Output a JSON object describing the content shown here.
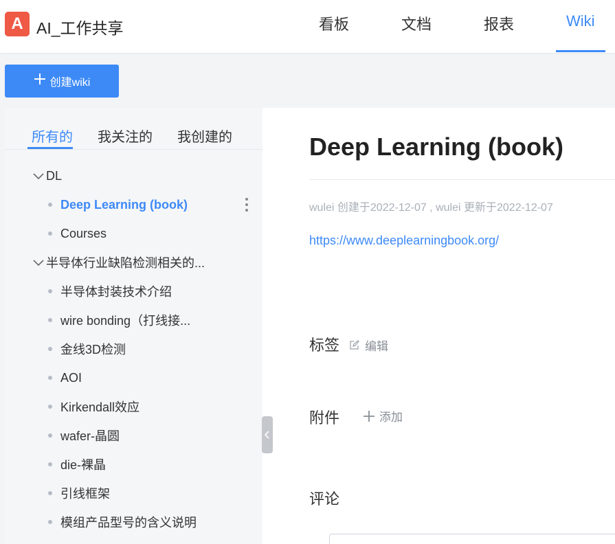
{
  "app": {
    "logo_letter": "A",
    "title": "AI_工作共享"
  },
  "nav": {
    "items": [
      "看板",
      "文档",
      "报表",
      "Wiki"
    ],
    "active": "Wiki"
  },
  "create_button": {
    "label": "创建wiki"
  },
  "sidebar": {
    "tabs": [
      "所有的",
      "我关注的",
      "我创建的"
    ],
    "active_tab": "所有的",
    "tree": [
      {
        "type": "folder",
        "label": "DL"
      },
      {
        "type": "leaf",
        "label": "Deep Learning (book)",
        "selected": true
      },
      {
        "type": "leaf",
        "label": "Courses"
      },
      {
        "type": "folder",
        "label": "半导体行业缺陷检测相关的..."
      },
      {
        "type": "leaf",
        "label": "半导体封装技术介绍"
      },
      {
        "type": "leaf",
        "label": "wire bonding（打线接..."
      },
      {
        "type": "leaf",
        "label": "金线3D检测"
      },
      {
        "type": "leaf",
        "label": "AOI"
      },
      {
        "type": "leaf",
        "label": "Kirkendall效应"
      },
      {
        "type": "leaf",
        "label": "wafer-晶圆"
      },
      {
        "type": "leaf",
        "label": "die-裸晶"
      },
      {
        "type": "leaf",
        "label": "引线框架"
      },
      {
        "type": "leaf",
        "label": "模组产品型号的含义说明"
      }
    ]
  },
  "main": {
    "title": "Deep Learning (book)",
    "meta": "wulei 创建于2022-12-07 , wulei 更新于2022-12-07",
    "link": "https://www.deeplearningbook.org/",
    "tags": {
      "title": "标签",
      "edit_label": "编辑"
    },
    "attachments": {
      "title": "附件",
      "add_label": "添加"
    },
    "comments": {
      "title": "评论"
    }
  },
  "colors": {
    "accent": "#3d8af7",
    "logo": "#ee5a45"
  }
}
